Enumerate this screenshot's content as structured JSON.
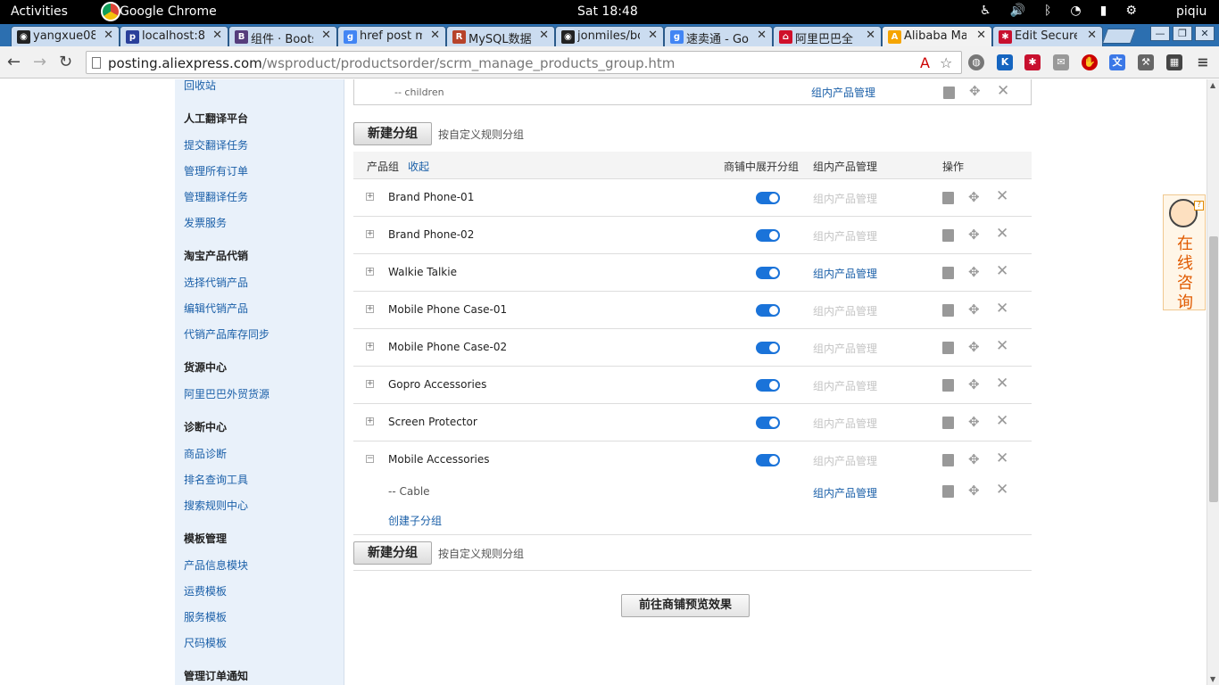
{
  "topbar": {
    "activities": "Activities",
    "app_name": "Google Chrome",
    "clock": "Sat 18:48",
    "user": "piqiu",
    "sys_icons": [
      "accessibility-icon",
      "volume-icon",
      "bluetooth-icon",
      "wifi-icon",
      "battery-icon",
      "user-icon"
    ]
  },
  "tabs": [
    {
      "label": "yangxue08",
      "icon": "github-icon"
    },
    {
      "label": "localhost:8",
      "icon": "phpmyadmin-icon"
    },
    {
      "label": "组件 · Boots",
      "icon": "bootstrap-icon"
    },
    {
      "label": "href post m",
      "icon": "google-icon"
    },
    {
      "label": "MySQL数据",
      "icon": "runoob-icon"
    },
    {
      "label": "jonmiles/bo",
      "icon": "github-icon"
    },
    {
      "label": "速卖通 - Go",
      "icon": "google-icon"
    },
    {
      "label": "阿里巴巴全",
      "icon": "alibaba-icon"
    },
    {
      "label": "Alibaba Ma",
      "icon": "aliexpress-icon",
      "active": true
    },
    {
      "label": "Edit Secure",
      "icon": "lastpass-icon"
    }
  ],
  "url": {
    "host": "posting.aliexpress.com",
    "path": "/wsproduct/productsorder/scrm_manage_products_group.htm"
  },
  "sidebar": {
    "top_link": "回收站",
    "sections": [
      {
        "title": "人工翻译平台",
        "links": [
          "提交翻译任务",
          "管理所有订单",
          "管理翻译任务",
          "发票服务"
        ]
      },
      {
        "title": "淘宝产品代销",
        "links": [
          "选择代销产品",
          "编辑代销产品",
          "代销产品库存同步"
        ]
      },
      {
        "title": "货源中心",
        "links": [
          "阿里巴巴外贸货源"
        ]
      },
      {
        "title": "诊断中心",
        "links": [
          "商品诊断",
          "排名查询工具",
          "搜索规则中心"
        ]
      },
      {
        "title": "模板管理",
        "links": [
          "产品信息模块",
          "运费模板",
          "服务模板",
          "尺码模板"
        ]
      },
      {
        "title": "管理订单通知",
        "links": []
      }
    ]
  },
  "main": {
    "prev_child": {
      "label": "-- children",
      "manage": "组内产品管理"
    },
    "new_group_button": "新建分组",
    "custom_rule_hint": "按自定义规则分组",
    "header": {
      "group": "产品组",
      "collapse": "收起",
      "show_in_store": "商铺中展开分组",
      "manage": "组内产品管理",
      "actions": "操作"
    },
    "groups": [
      {
        "name": "Brand Phone-01",
        "expander": "+",
        "shown": true,
        "manage": "组内产品管理",
        "manage_active": false
      },
      {
        "name": "Brand Phone-02",
        "expander": "+",
        "shown": true,
        "manage": "组内产品管理",
        "manage_active": false
      },
      {
        "name": "Walkie Talkie",
        "expander": "+",
        "shown": true,
        "manage": "组内产品管理",
        "manage_active": true
      },
      {
        "name": "Mobile Phone Case-01",
        "expander": "+",
        "shown": true,
        "manage": "组内产品管理",
        "manage_active": false
      },
      {
        "name": "Mobile Phone Case-02",
        "expander": "+",
        "shown": true,
        "manage": "组内产品管理",
        "manage_active": false
      },
      {
        "name": "Gopro Accessories",
        "expander": "+",
        "shown": true,
        "manage": "组内产品管理",
        "manage_active": false
      },
      {
        "name": "Screen Protector",
        "expander": "+",
        "shown": true,
        "manage": "组内产品管理",
        "manage_active": false
      },
      {
        "name": "Mobile Accessories",
        "expander": "−",
        "shown": true,
        "manage": "组内产品管理",
        "manage_active": false
      }
    ],
    "subgroup": {
      "name": "-- Cable",
      "manage": "组内产品管理",
      "create_sub": "创建子分组"
    },
    "preview_button": "前往商铺预览效果"
  },
  "chat_widget": {
    "text": "在线咨询",
    "badge": "?"
  }
}
